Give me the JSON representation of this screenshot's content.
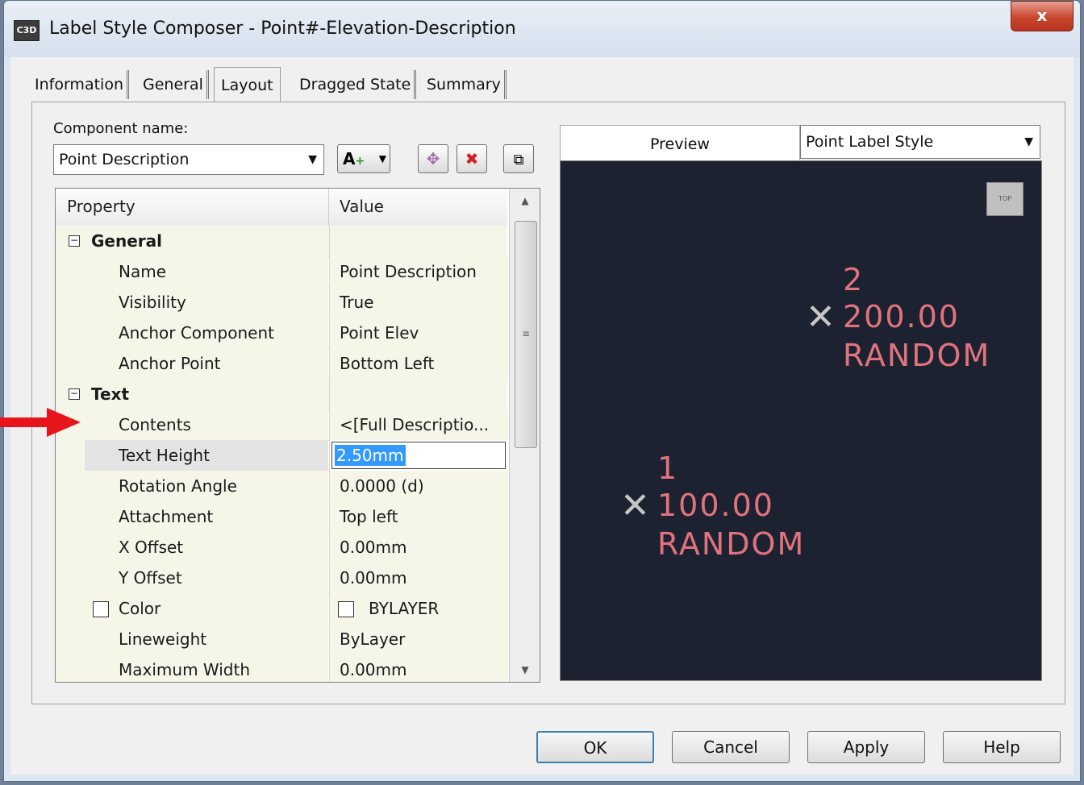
{
  "window": {
    "title": "Label Style Composer - Point#-Elevation-Description",
    "close_label": "x"
  },
  "tabs": [
    {
      "label": "Information"
    },
    {
      "label": "General"
    },
    {
      "label": "Layout"
    },
    {
      "label": "Dragged State"
    },
    {
      "label": "Summary"
    }
  ],
  "component": {
    "label": "Component name:",
    "selected": "Point Description"
  },
  "grid": {
    "header_property": "Property",
    "header_value": "Value",
    "rows": [
      {
        "type": "category",
        "property": "General",
        "value": ""
      },
      {
        "type": "item",
        "property": "Name",
        "value": "Point Description"
      },
      {
        "type": "item",
        "property": "Visibility",
        "value": "True"
      },
      {
        "type": "item",
        "property": "Anchor Component",
        "value": "Point Elev"
      },
      {
        "type": "item",
        "property": "Anchor Point",
        "value": "Bottom Left"
      },
      {
        "type": "category",
        "property": "Text",
        "value": ""
      },
      {
        "type": "item",
        "property": "Contents",
        "value": "<[Full Descriptio..."
      },
      {
        "type": "item",
        "property": "Text Height",
        "value": "2.50mm"
      },
      {
        "type": "item",
        "property": "Rotation Angle",
        "value": "0.0000 (d)"
      },
      {
        "type": "item",
        "property": "Attachment",
        "value": "Top left"
      },
      {
        "type": "item",
        "property": "X Offset",
        "value": "0.00mm"
      },
      {
        "type": "item",
        "property": "Y Offset",
        "value": "0.00mm"
      },
      {
        "type": "item",
        "property": "Color",
        "value": "BYLAYER"
      },
      {
        "type": "item",
        "property": "Lineweight",
        "value": "ByLayer"
      },
      {
        "type": "item",
        "property": "Maximum Width",
        "value": "0.00mm"
      }
    ]
  },
  "preview": {
    "tab_label": "Preview",
    "style_selected": "Point Label Style",
    "viewcube_label": "TOP",
    "points": [
      {
        "number": "2",
        "elevation": "200.00",
        "description": "RANDOM"
      },
      {
        "number": "1",
        "elevation": "100.00",
        "description": "RANDOM"
      }
    ],
    "label_color": "#e0737e",
    "background_color": "#1c2230"
  },
  "buttons": {
    "ok": "OK",
    "cancel": "Cancel",
    "apply": "Apply",
    "help": "Help"
  }
}
